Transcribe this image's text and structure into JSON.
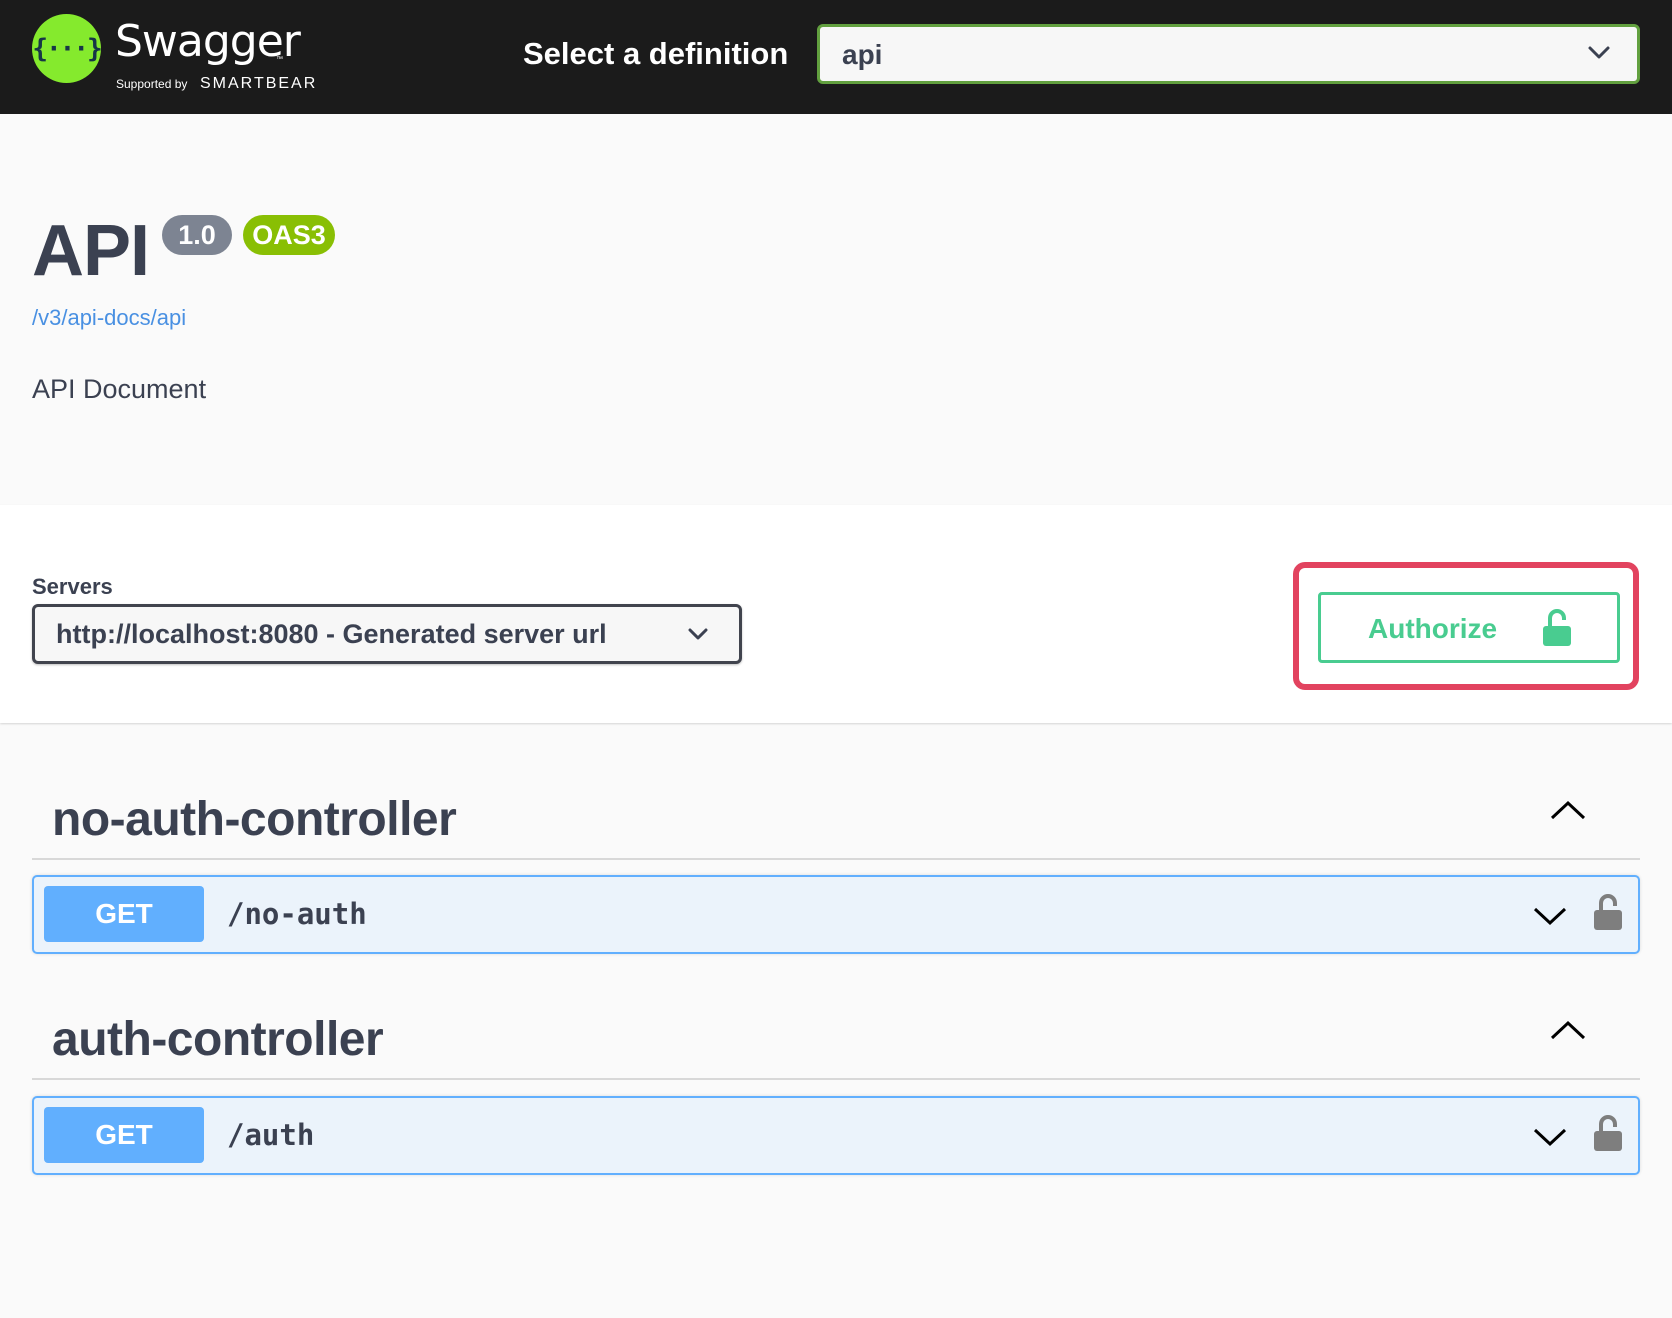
{
  "header": {
    "brand": "Swagger",
    "brand_tm": "™",
    "supported_by": "Supported by",
    "supporter": "SMARTBEAR",
    "logo_glyph": "{···}",
    "definition_label": "Select a definition",
    "definition_value": "api"
  },
  "info": {
    "title": "API",
    "version": "1.0",
    "oas_badge": "OAS3",
    "spec_link": "/v3/api-docs/api",
    "description": "API Document"
  },
  "servers": {
    "label": "Servers",
    "selected": "http://localhost:8080 - Generated server url"
  },
  "authorize": {
    "label": "Authorize",
    "icon": "unlock-icon"
  },
  "tags": [
    {
      "name": "no-auth-controller",
      "operations": [
        {
          "method": "GET",
          "path": "/no-auth"
        }
      ]
    },
    {
      "name": "auth-controller",
      "operations": [
        {
          "method": "GET",
          "path": "/auth"
        }
      ]
    }
  ],
  "colors": {
    "topbar": "#1b1b1b",
    "logo": "#85ea2d",
    "select_border": "#62a03f",
    "authorize": "#49cc90",
    "highlight": "#e2435f",
    "get": "#61affe",
    "version_badge": "#7d8492",
    "oas_badge": "#89bf04"
  }
}
